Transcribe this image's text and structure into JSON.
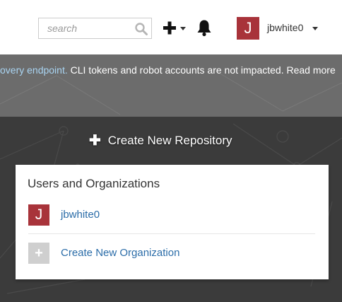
{
  "header": {
    "search": {
      "placeholder": "search",
      "value": ""
    },
    "user": {
      "avatar_letter": "J",
      "username": "jbwhite0"
    }
  },
  "banner": {
    "link_text": "overy endpoint.",
    "text": " CLI tokens and robot accounts are not impacted. Read more"
  },
  "main": {
    "create_repo_label": "Create New Repository",
    "panel": {
      "title": "Users and Organizations",
      "user_row": {
        "avatar_letter": "J",
        "name": "jbwhite0"
      },
      "org_row": {
        "icon_text": "+",
        "label": "Create New Organization"
      }
    }
  },
  "colors": {
    "avatar": "#a8333a",
    "link": "#2a6ca8",
    "banner_bg": "#6c6c6c",
    "page_bg": "#3b3b3b"
  }
}
